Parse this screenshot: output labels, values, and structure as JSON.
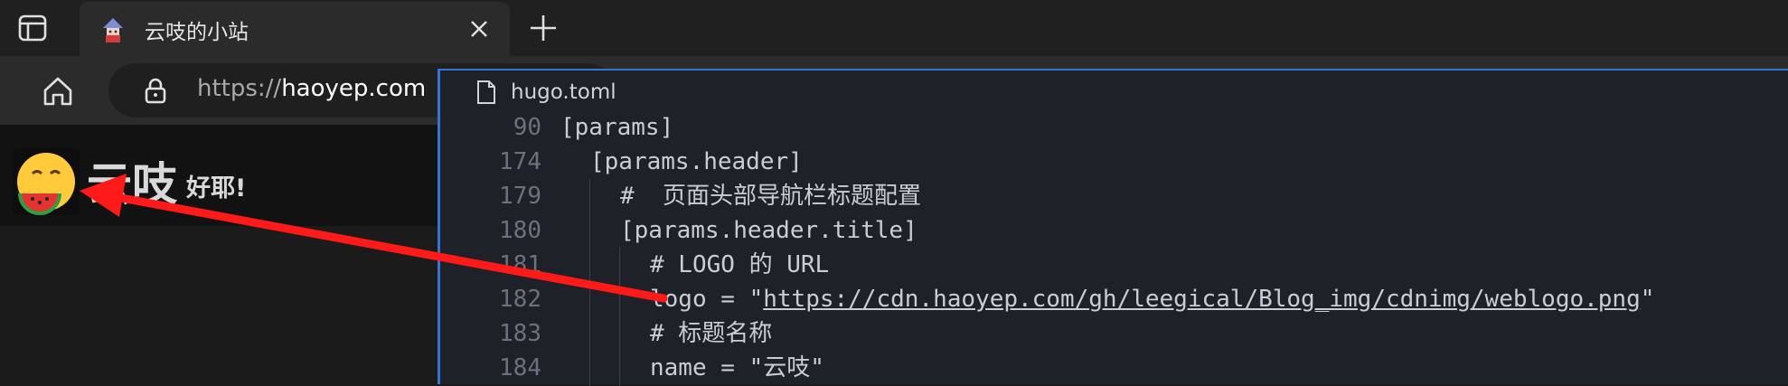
{
  "browser": {
    "tab": {
      "title": "云吱的小站"
    },
    "address": {
      "scheme": "https://",
      "host": "haoyep.com"
    }
  },
  "site": {
    "title": "云吱",
    "subtitle": "好耶!"
  },
  "editor": {
    "file_name": "hugo.toml",
    "lines": [
      {
        "num": "90",
        "text": "[params]"
      },
      {
        "num": "174",
        "text": "[params.header]"
      },
      {
        "num": "179",
        "text": "#  页面头部导航栏标题配置"
      },
      {
        "num": "180",
        "text": "[params.header.title]"
      },
      {
        "num": "181",
        "text": "# LOGO 的 URL"
      },
      {
        "num": "182",
        "prefix": "logo = \"",
        "link": "https://cdn.haoyep.com/gh/leegical/Blog_img/cdnimg/weblogo.png",
        "suffix": "\""
      },
      {
        "num": "183",
        "text": "# 标题名称"
      },
      {
        "num": "184",
        "text": "name = \"云吱\""
      }
    ]
  },
  "colors": {
    "accent": "#3574d4",
    "arrow": "#ff1a1a"
  }
}
